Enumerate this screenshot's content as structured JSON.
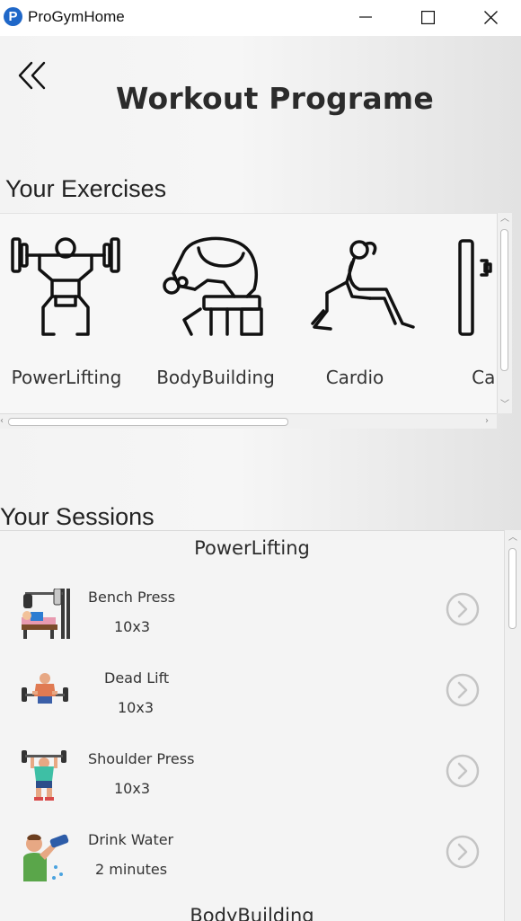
{
  "window": {
    "logo_letter": "P",
    "title": "ProGymHome"
  },
  "page": {
    "title": "Workout Programe"
  },
  "exercises": {
    "heading": "Your Exercises",
    "items": [
      {
        "label": "PowerLifting",
        "icon": "squat-barbell-icon"
      },
      {
        "label": "BodyBuilding",
        "icon": "bicep-curl-icon"
      },
      {
        "label": "Cardio",
        "icon": "lunge-icon"
      },
      {
        "label": "Calis",
        "icon": "calisthenics-icon"
      }
    ]
  },
  "sessions": {
    "heading": "Your Sessions",
    "groups": [
      {
        "title": "PowerLifting",
        "items": [
          {
            "name": "Bench Press",
            "detail": "10x3",
            "icon": "bench-press-icon"
          },
          {
            "name": "Dead Lift",
            "detail": "10x3",
            "icon": "deadlift-icon"
          },
          {
            "name": "Shoulder Press",
            "detail": "10x3",
            "icon": "shoulder-press-icon"
          },
          {
            "name": "Drink Water",
            "detail": "2 minutes",
            "icon": "drink-water-icon"
          }
        ]
      },
      {
        "title": "BodyBuilding",
        "items": []
      }
    ]
  },
  "colors": {
    "accent": "#1f67c8",
    "text": "#2b2b2b",
    "go_button": "#c4c4c4"
  }
}
